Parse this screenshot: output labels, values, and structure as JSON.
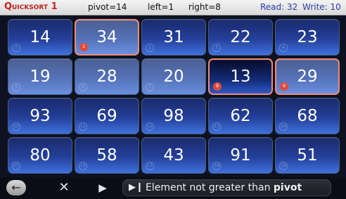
{
  "header": {
    "title": "Quicksort 1",
    "pivot": "pivot=14",
    "left": "left=1",
    "right": "right=8",
    "read": "Read: 32",
    "write": "Write: 10"
  },
  "grid": {
    "cells": [
      {
        "value": "14",
        "index": "0"
      },
      {
        "value": "34",
        "index": "1"
      },
      {
        "value": "31",
        "index": "2"
      },
      {
        "value": "22",
        "index": "3"
      },
      {
        "value": "23",
        "index": "4"
      },
      {
        "value": "19",
        "index": "5"
      },
      {
        "value": "28",
        "index": "6"
      },
      {
        "value": "20",
        "index": "7"
      },
      {
        "value": "13",
        "index": "8"
      },
      {
        "value": "29",
        "index": "9"
      },
      {
        "value": "93",
        "index": "10"
      },
      {
        "value": "69",
        "index": "11"
      },
      {
        "value": "98",
        "index": "12"
      },
      {
        "value": "62",
        "index": "13"
      },
      {
        "value": "68",
        "index": "14"
      },
      {
        "value": "80",
        "index": "15"
      },
      {
        "value": "58",
        "index": "16"
      },
      {
        "value": "43",
        "index": "17"
      },
      {
        "value": "91",
        "index": "18"
      },
      {
        "value": "51",
        "index": "19"
      }
    ]
  },
  "toolbar": {
    "back_icon": "back-arrow-icon",
    "close_icon": "close-icon",
    "play_icon": "play-icon",
    "step_icon": "step-forward-icon",
    "hint_text": "Element not greater than ",
    "hint_bold": "pivot"
  },
  "colors": {
    "title": "#c31f1f",
    "counter": "#2c3fa8",
    "highlight_border": "#f08a78",
    "active_index": "#e04a3c"
  }
}
